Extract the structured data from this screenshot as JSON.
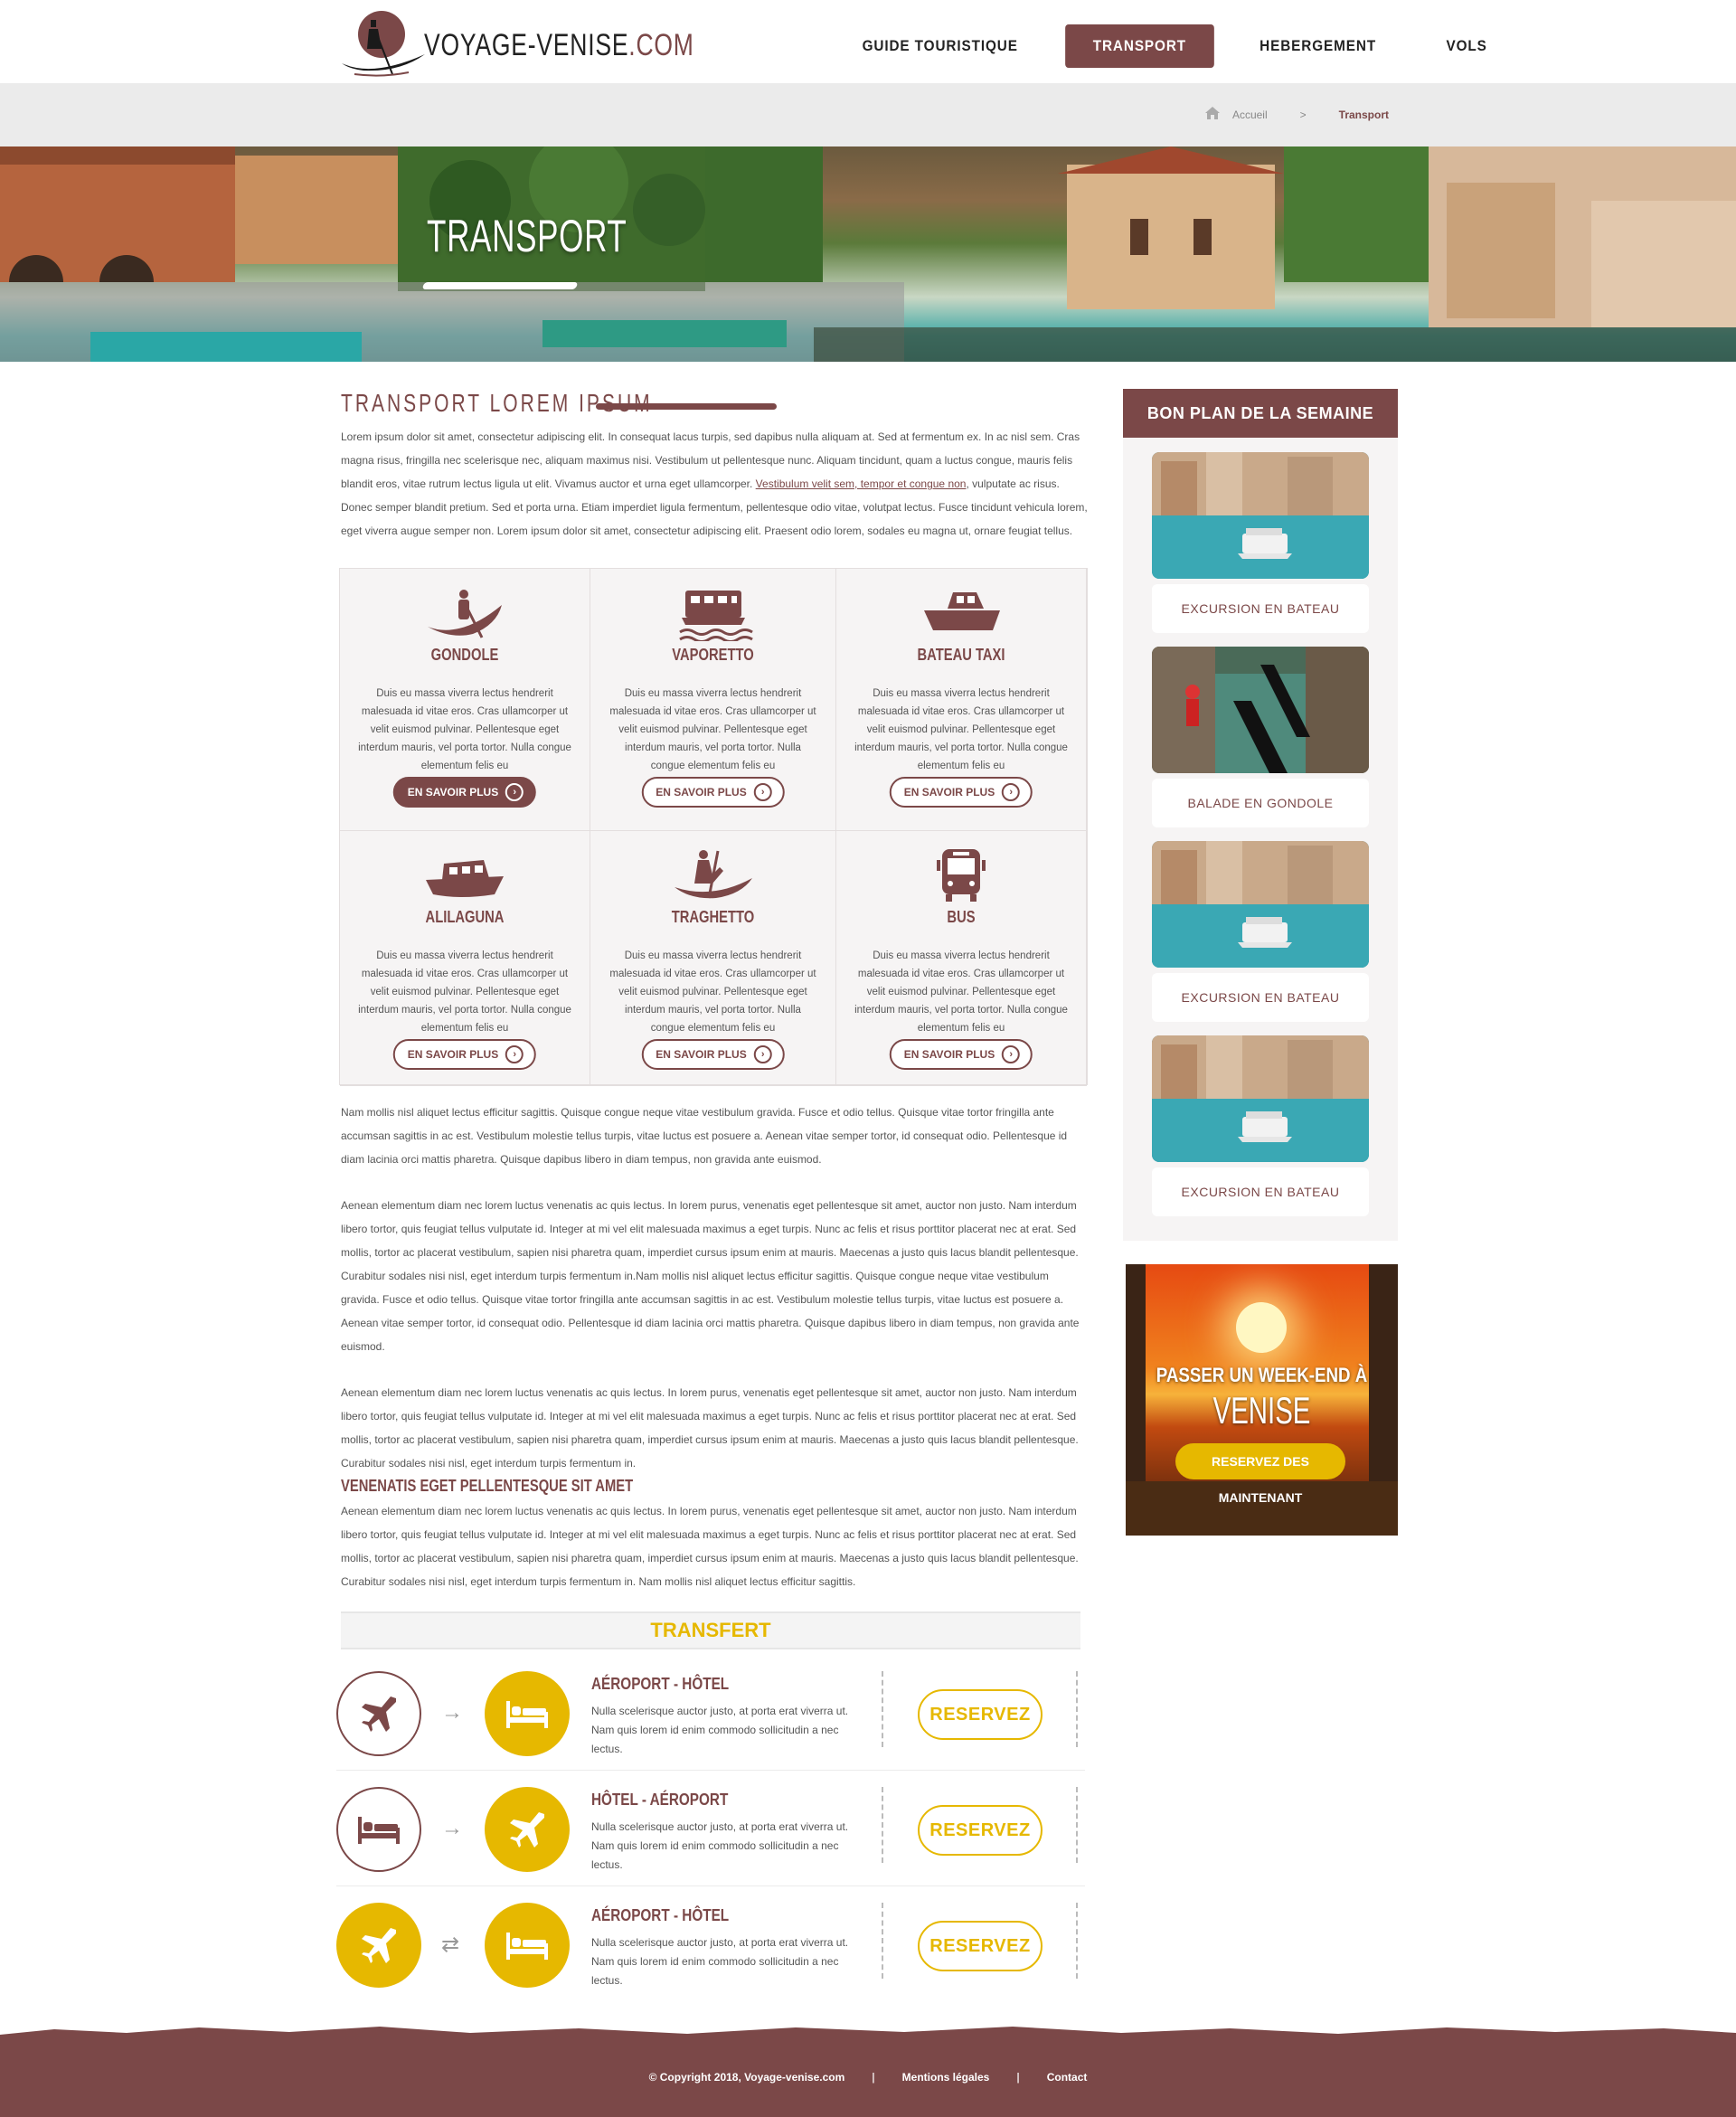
{
  "site": {
    "logo_text": "VOYAGE-VENISE",
    "logo_tld": ".COM"
  },
  "nav": [
    {
      "label": "GUIDE TOURISTIQUE",
      "active": false
    },
    {
      "label": "TRANSPORT",
      "active": true
    },
    {
      "label": "HEBERGEMENT",
      "active": false
    },
    {
      "label": "VOLS",
      "active": false
    }
  ],
  "breadcrumb": {
    "home": "Accueil",
    "separator": ">",
    "current": "Transport"
  },
  "hero": {
    "title": "TRANSPORT"
  },
  "intro": {
    "heading": "TRANSPORT LOREM IPSUM",
    "text_before_link": "Lorem ipsum dolor sit amet, consectetur adipiscing elit. In consequat lacus turpis, sed dapibus nulla aliquam at. Sed at fermentum ex. In ac nisl sem. Cras magna risus, fringilla nec scelerisque nec, aliquam maximus nisi. Vestibulum ut pellentesque nunc. Aliquam tincidunt, quam a luctus congue, mauris felis blandit eros, vitae rutrum lectus ligula ut elit. Vivamus auctor et urna eget ullamcorper. ",
    "link_text": "Vestibulum velit sem, tempor et congue non",
    "text_after_link": ", vulputate ac risus. Donec semper blandit pretium. Sed et porta urna. Etiam imperdiet ligula fermentum, pellentesque odio vitae, volutpat lectus. Fusce tincidunt vehicula lorem, eget viverra augue semper non. Lorem ipsum dolor sit amet, consectetur adipiscing elit. Praesent odio lorem, sodales eu magna ut, ornare feugiat tellus."
  },
  "transports": [
    {
      "icon": "gondola-icon",
      "title": "GONDOLE",
      "desc": "Duis eu massa viverra lectus hendrerit malesuada id vitae eros. Cras ullamcorper ut velit euismod pulvinar. Pellentesque eget interdum mauris, vel porta tortor. Nulla congue elementum felis eu",
      "button": "EN SAVOIR PLUS",
      "filled": true
    },
    {
      "icon": "vaporetto-icon",
      "title": "VAPORETTO",
      "desc": "Duis eu massa viverra lectus hendrerit malesuada id vitae eros. Cras ullamcorper ut velit euismod pulvinar. Pellentesque eget interdum mauris, vel porta tortor. Nulla congue elementum felis eu",
      "button": "EN SAVOIR PLUS",
      "filled": false
    },
    {
      "icon": "water-taxi-icon",
      "title": "BATEAU TAXI",
      "desc": "Duis eu massa viverra lectus hendrerit malesuada id vitae eros. Cras ullamcorper ut velit euismod pulvinar. Pellentesque eget interdum mauris, vel porta tortor. Nulla congue elementum felis eu",
      "button": "EN SAVOIR PLUS",
      "filled": false
    },
    {
      "icon": "alilaguna-boat-icon",
      "title": "ALILAGUNA",
      "desc": "Duis eu massa viverra lectus hendrerit malesuada id vitae eros. Cras ullamcorper ut velit euismod pulvinar. Pellentesque eget interdum mauris, vel porta tortor. Nulla congue elementum felis eu",
      "button": "EN SAVOIR PLUS",
      "filled": false
    },
    {
      "icon": "traghetto-icon",
      "title": "TRAGHETTO",
      "desc": "Duis eu massa viverra lectus hendrerit malesuada id vitae eros. Cras ullamcorper ut velit euismod pulvinar. Pellentesque eget interdum mauris, vel porta tortor. Nulla congue elementum felis eu",
      "button": "EN SAVOIR PLUS",
      "filled": false
    },
    {
      "icon": "bus-icon",
      "title": "BUS",
      "desc": "Duis eu massa viverra lectus hendrerit malesuada id vitae eros. Cras ullamcorper ut velit euismod pulvinar. Pellentesque eget interdum mauris, vel porta tortor. Nulla congue elementum felis eu",
      "button": "EN SAVOIR PLUS",
      "filled": false
    }
  ],
  "body_paragraphs": [
    "Nam mollis nisl aliquet lectus efficitur sagittis. Quisque congue neque vitae vestibulum gravida. Fusce et odio tellus. Quisque vitae tortor fringilla ante accumsan sagittis in ac est. Vestibulum molestie tellus turpis, vitae luctus est posuere a. Aenean vitae semper tortor, id consequat odio. Pellentesque id diam lacinia orci mattis pharetra. Quisque dapibus libero in diam tempus, non gravida ante euismod.",
    "Aenean elementum diam nec lorem luctus venenatis ac quis lectus. In lorem purus, venenatis eget pellentesque sit amet, auctor non justo. Nam interdum libero tortor, quis feugiat tellus vulputate id. Integer at mi vel elit malesuada maximus a eget turpis. Nunc ac felis et risus porttitor placerat nec at erat. Sed mollis, tortor ac placerat vestibulum, sapien nisi pharetra quam, imperdiet cursus ipsum enim at mauris. Maecenas a justo quis lacus blandit pellentesque. Curabitur sodales nisi nisl, eget interdum turpis fermentum in.Nam mollis nisl aliquet lectus efficitur sagittis. Quisque congue neque vitae vestibulum gravida. Fusce et odio tellus. Quisque vitae tortor fringilla ante accumsan sagittis in ac est. Vestibulum molestie tellus turpis, vitae luctus est posuere a. Aenean vitae semper tortor, id consequat odio. Pellentesque id diam lacinia orci mattis pharetra. Quisque dapibus libero in diam tempus, non gravida ante euismod.",
    "Aenean elementum diam nec lorem luctus venenatis ac quis lectus. In lorem purus, venenatis eget pellentesque sit amet, auctor non justo. Nam interdum libero tortor, quis feugiat tellus vulputate id. Integer at mi vel elit malesuada maximus a eget turpis. Nunc ac felis et risus porttitor placerat nec at erat. Sed mollis, tortor ac placerat vestibulum, sapien nisi pharetra quam, imperdiet cursus ipsum enim at mauris. Maecenas a justo quis lacus blandit pellentesque. Curabitur sodales nisi nisl, eget interdum turpis fermentum in."
  ],
  "section2": {
    "heading": "VENENATIS EGET PELLENTESQUE SIT AMET",
    "text": "Aenean elementum diam nec lorem luctus venenatis ac quis lectus. In lorem purus, venenatis eget pellentesque sit amet, auctor non justo. Nam interdum libero tortor, quis feugiat tellus vulputate id. Integer at mi vel elit malesuada maximus a eget turpis. Nunc ac felis et risus porttitor placerat nec at erat. Sed mollis, tortor ac placerat vestibulum, sapien nisi pharetra quam, imperdiet cursus ipsum enim at mauris. Maecenas a justo quis lacus blandit pellentesque. Curabitur sodales nisi nisl, eget interdum turpis fermentum in. Nam mollis nisl aliquet lectus efficitur sagittis."
  },
  "transfer": {
    "heading": "TRANSFERT",
    "rows": [
      {
        "title": "AÉROPORT - HÔTEL",
        "desc": "Nulla scelerisque auctor justo, at porta erat viverra ut. Nam quis lorem id enim commodo sollicitudin a nec lectus.",
        "button": "RESERVEZ",
        "from_icon": "plane-icon",
        "to_icon": "bed-icon",
        "arrow": "→"
      },
      {
        "title": "HÔTEL - AÉROPORT",
        "desc": "Nulla scelerisque auctor justo, at porta erat viverra ut. Nam quis lorem id enim commodo sollicitudin a nec lectus.",
        "button": "RESERVEZ",
        "from_icon": "bed-icon",
        "to_icon": "plane-icon",
        "arrow": "→"
      },
      {
        "title": "AÉROPORT - HÔTEL",
        "desc": "Nulla scelerisque auctor justo, at porta erat viverra ut. Nam quis lorem id enim commodo sollicitudin a nec lectus.",
        "button": "RESERVEZ",
        "from_icon": "plane-icon",
        "to_icon": "bed-icon",
        "arrow": "⇄"
      }
    ]
  },
  "sidebar": {
    "heading": "BON PLAN DE LA SEMAINE",
    "cards": [
      {
        "caption": "EXCURSION EN BATEAU"
      },
      {
        "caption": "BALADE EN GONDOLE"
      },
      {
        "caption": "EXCURSION EN BATEAU"
      },
      {
        "caption": "EXCURSION EN BATEAU"
      }
    ]
  },
  "ad": {
    "line1": "PASSER UN WEEK-END À",
    "line2": "VENISE",
    "button": "RESERVEZ DES MAINTENANT"
  },
  "footer": {
    "copyright": "©   Copyright 2018, Voyage-venise.com",
    "link1": "Mentions légales",
    "link2": "Contact",
    "separator": "|"
  },
  "colors": {
    "brand": "#7b4848",
    "accent": "#e6b800",
    "grey_bar": "#ebebeb"
  }
}
